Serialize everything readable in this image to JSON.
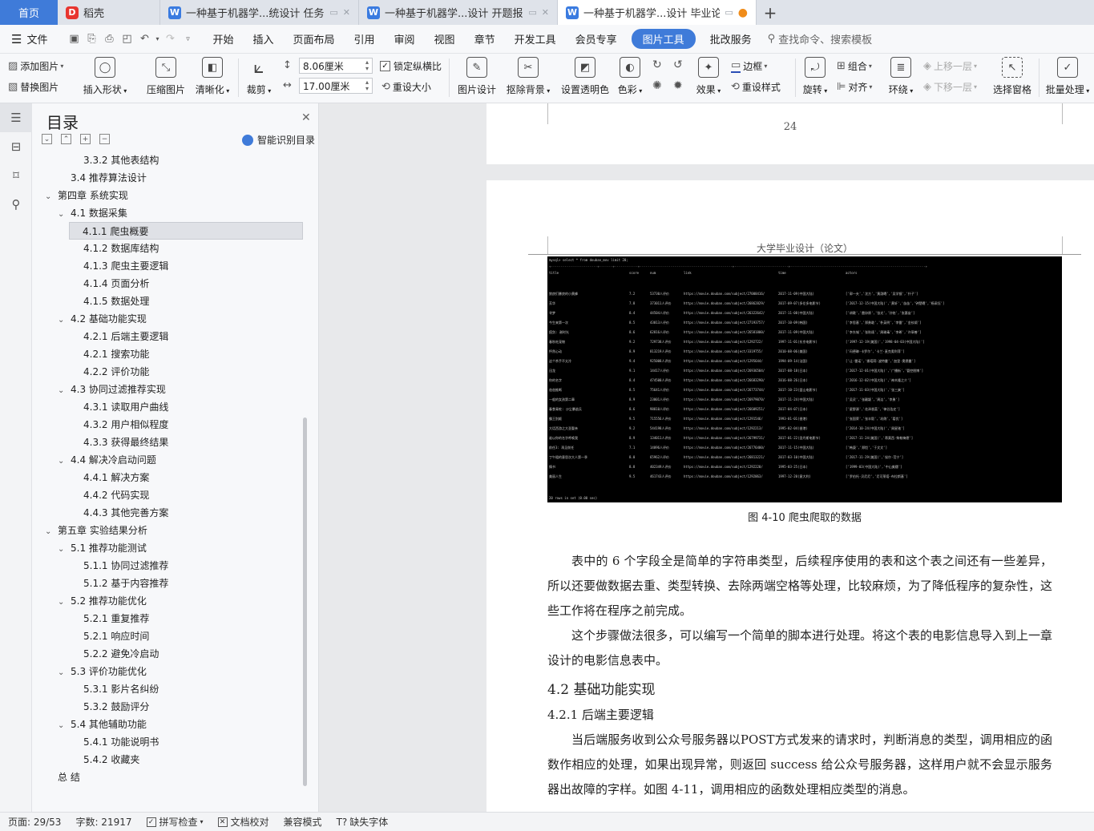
{
  "tabs": [
    {
      "label": "首页",
      "kind": "home"
    },
    {
      "label": "稻壳",
      "kind": "docer"
    },
    {
      "label": "一种基于机器学...统设计 任务书",
      "kind": "doc"
    },
    {
      "label": "一种基于机器学...设计 开题报告",
      "kind": "doc"
    },
    {
      "label": "一种基于机器学...设计 毕业论文",
      "kind": "doc",
      "active": true
    }
  ],
  "menu": {
    "file": "文件",
    "items": [
      "开始",
      "插入",
      "页面布局",
      "引用",
      "审阅",
      "视图",
      "章节",
      "开发工具",
      "会员专享",
      "图片工具",
      "批改服务"
    ],
    "active": "图片工具",
    "search": "查找命令、搜索模板"
  },
  "ribbon": {
    "add_image": "添加图片",
    "replace_image": "替换图片",
    "insert_shape": "插入形状",
    "compress": "压缩图片",
    "sharpen": "清晰化",
    "crop": "裁剪",
    "width": "8.06厘米",
    "height": "17.00厘米",
    "lock_ratio": "锁定纵横比",
    "reset_size": "重设大小",
    "image_design": "图片设计",
    "remove_bg": "抠除背景",
    "set_transparent": "设置透明色",
    "color": "色彩",
    "effects": "效果",
    "border": "边框",
    "reset_style": "重设样式",
    "rotate": "旋转",
    "group": "组合",
    "align": "对齐",
    "wrap": "环绕",
    "bring_forward": "上移一层",
    "send_backward": "下移一层",
    "selection_pane": "选择窗格",
    "batch": "批量处理"
  },
  "toc": {
    "title": "目录",
    "smart": "智能识别目录",
    "items": [
      {
        "label": "3.3.2 其他表结构",
        "level": 3
      },
      {
        "label": "3.4 推荐算法设计",
        "level": 2
      },
      {
        "label": "第四章 系统实现",
        "level": 1,
        "caret": true
      },
      {
        "label": "4.1 数据采集",
        "level": 2,
        "caret": true
      },
      {
        "label": "4.1.1 爬虫概要",
        "level": 3,
        "selected": true
      },
      {
        "label": "4.1.2 数据库结构",
        "level": 3
      },
      {
        "label": "4.1.3 爬虫主要逻辑",
        "level": 3
      },
      {
        "label": "4.1.4 页面分析",
        "level": 3
      },
      {
        "label": "4.1.5 数据处理",
        "level": 3
      },
      {
        "label": "4.2 基础功能实现",
        "level": 2,
        "caret": true
      },
      {
        "label": "4.2.1 后端主要逻辑",
        "level": 3
      },
      {
        "label": "4.2.1 搜索功能",
        "level": 3
      },
      {
        "label": "4.2.2 评价功能",
        "level": 3
      },
      {
        "label": "4.3 协同过滤推荐实现",
        "level": 2,
        "caret": true
      },
      {
        "label": "4.3.1 读取用户曲线",
        "level": 3
      },
      {
        "label": "4.3.2 用户相似程度",
        "level": 3
      },
      {
        "label": "4.3.3 获得最终结果",
        "level": 3
      },
      {
        "label": "4.4 解决冷启动问题",
        "level": 2,
        "caret": true
      },
      {
        "label": "4.4.1 解决方案",
        "level": 3
      },
      {
        "label": "4.4.2 代码实现",
        "level": 3
      },
      {
        "label": "4.4.3 其他完善方案",
        "level": 3
      },
      {
        "label": "第五章 实验结果分析",
        "level": 1,
        "caret": true
      },
      {
        "label": "5.1 推荐功能测试",
        "level": 2,
        "caret": true
      },
      {
        "label": "5.1.1 协同过滤推荐",
        "level": 3
      },
      {
        "label": "5.1.2 基于内容推荐",
        "level": 3
      },
      {
        "label": "5.2 推荐功能优化",
        "level": 2,
        "caret": true
      },
      {
        "label": "5.2.1 重复推荐",
        "level": 3
      },
      {
        "label": "5.2.1 响应时间",
        "level": 3
      },
      {
        "label": "5.2.2 避免冷启动",
        "level": 3
      },
      {
        "label": "5.3 评价功能优化",
        "level": 2,
        "caret": true
      },
      {
        "label": "5.3.1 影片名纠纷",
        "level": 3
      },
      {
        "label": "5.3.2 鼓励评分",
        "level": 3
      },
      {
        "label": "5.4 其他辅助功能",
        "level": 2,
        "caret": true
      },
      {
        "label": "5.4.1 功能说明书",
        "level": 3
      },
      {
        "label": "5.4.2 收藏夹",
        "level": 3
      },
      {
        "label": "总 结",
        "level": 1
      }
    ]
  },
  "doc": {
    "prev_page_number": "24",
    "header": "大学毕业设计（论文）",
    "terminal": {
      "prompt": "mysql> select * from douban_mov limit 20;",
      "columns": [
        "title",
        "score",
        "num",
        "link",
        "time",
        "actors"
      ],
      "rows": [
        [
          "狼戾们暴戾的小黄蜂",
          "7.2",
          "53730人评价",
          "https://movie.douban.com/subject/27008416/",
          "2017-11-09(中国大陆)",
          "['郭一夫','沈方','黄渤曦','吴学镜','扑子']"
        ],
        [
          "芳华",
          "7.8",
          "373011人评价",
          "https://movie.douban.com/subject/26862829/",
          "2017-09-07(多伦多电影节)",
          "['2017-12-15(中国大陆)','黄轩','苗苗','钟楚曦','杨采钰']"
        ],
        [
          "寻梦",
          "8.4",
          "44504人评价",
          "https://movie.douban.com/subject/26322642/",
          "2017-11-08(中国大陆)",
          "['胡歌','雷卯原','张光','孙铭','张惠宙']"
        ],
        [
          "今生来第一次",
          "8.5",
          "43013人评价",
          "https://movie.douban.com/subject/27193757/",
          "2017-10-09(韩国)",
          "['李思基','郑勇敢','朴英明','李雷','金钦颂']"
        ],
        [
          "痞剑: 谢时光",
          "8.6",
          "62816人评价",
          "https://movie.douban.com/subject/26581800/",
          "2017-11-09(中国大陆)",
          "['李东城','张秋颂','周瑜毒','李希','许翠善']"
        ],
        [
          "春秋吃宠物",
          "9.2",
          "729738人评价",
          "https://movie.douban.com/subject/1292722/",
          "1997-11-01(东京电影节)",
          "['1997-12-19(美国)','1998-04-03(中国大陆)']"
        ],
        [
          "怦然心动",
          "8.9",
          "813219人评价",
          "https://movie.douban.com/subject/3319755/",
          "2010-08-06(美国)",
          "['玛德琳·卡罗尔','卡兰·麦克奥利菲']"
        ],
        [
          "这个杀手不太冷",
          "9.4",
          "925008人评价",
          "https://movie.douban.com/subject/1295644/",
          "1994-09-14(法国)",
          "['让·雷诺','娜塔莉·波特曼','加里·奥德曼']"
        ],
        [
          "迅龙",
          "9.1",
          "14417人评价",
          "https://movie.douban.com/subject/26936504/",
          "2017-08-18(日本)",
          "['2017-12-01(中国大陆)','广播街','管控朋博']"
        ],
        [
          "你的名字",
          "8.4",
          "474500人评价",
          "https://movie.douban.com/subject/26683290/",
          "2016-08-26(日本)",
          "['2016-12-02(中国大陆)','神木隆之介']"
        ],
        [
          "爸爸推断",
          "8.5",
          "75641人评价",
          "https://movie.douban.com/subject/26773744/",
          "2017-10-23(釜山电影节)",
          "['2017-11-03(中国大陆)','张三爽']"
        ],
        [
          "一般的女孩第二章",
          "8.9",
          "23001人评价",
          "https://movie.douban.com/subject/26979070/",
          "2017-11-24(中国大陆)",
          "['吴灵','张靓颖','周洁','李勇']"
        ],
        [
          "春食青蛇: 沙尘暴逃兵",
          "8.6",
          "98810人评价",
          "https://movie.douban.com/subject/26609251/",
          "2017-04-07(日本)",
          "['星野源','花泽香菜','神谷浩史']"
        ],
        [
          "霸王别姬",
          "9.5",
          "715556人评价",
          "https://movie.douban.com/subject/1291546/",
          "1993-01-01(香港)",
          "['张国荣','张丰毅','巩俐','葛优']"
        ],
        [
          "大话西游之大圣娶亲",
          "9.2",
          "544198人评价",
          "https://movie.douban.com/subject/1292213/",
          "1995-02-04(香港)",
          "['2014-10-24(中国大陆)','周星驰']"
        ],
        [
          "谁以你的名字呼唤我",
          "8.9",
          "134011人评价",
          "https://movie.douban.com/subject/26799731/",
          "2017-01-22(圣丹斯电影节)",
          "['2017-11-24(美国)','蒂莫西·柴勒梅德']"
        ],
        [
          "前任3: 再见前任",
          "7.1",
          "14096人评价",
          "https://movie.douban.com/subject/26776400/",
          "2017-11-15(中国大陆)",
          "['韩庚','郑恺','于文文']"
        ],
        [
          "丁午粗的意思次大人第一季",
          "8.0",
          "65962人评价",
          "https://movie.douban.com/subject/26813221/",
          "2017-03-10(中国大陆)",
          "['2017-11-29(美国)','埃尔·范宁']"
        ],
        [
          "情书",
          "8.8",
          "402349人评价",
          "https://movie.douban.com/subject/1292220/",
          "1995-03-25(日本)",
          "['1999-03(中国大陆)','中山美穗']"
        ],
        [
          "美丽人生",
          "9.5",
          "461743人评价",
          "https://movie.douban.com/subject/1292063/",
          "1997-12-20(意大利)",
          "['罗伯托·贝尼尼','尼可莱塔·布拉斯基']"
        ]
      ],
      "footer": "20 rows in set (0.00 sec)"
    },
    "caption": "图 4-10 爬虫爬取的数据",
    "p1": "表中的 6 个字段全是简单的字符串类型，后续程序使用的表和这个表之间还有一些差异，所以还要做数据去重、类型转换、去除两端空格等处理，比较麻烦，为了降低程序的复杂性，这些工作将在程序之前完成。",
    "p2": "这个步骤做法很多，可以编写一个简单的脚本进行处理。将这个表的电影信息导入到上一章设计的电影信息表中。",
    "h2": "4.2 基础功能实现",
    "h3": "4.2.1 后端主要逻辑",
    "p3": "当后端服务收到公众号服务器以POST方式发来的请求时，判断消息的类型，调用相应的函数作相应的处理，如果出现异常，则返回 success 给公众号服务器，这样用户就不会显示服务器出故障的字样。如图 4-11，调用相应的函数处理相应类型的消息。"
  },
  "status": {
    "page": "页面: 29/53",
    "words": "字数: 21917",
    "spell": "拼写检查",
    "proof": "文档校对",
    "compat": "兼容模式",
    "missing_font": "缺失字体"
  },
  "colors": {
    "accent": "#3f7bd9"
  }
}
